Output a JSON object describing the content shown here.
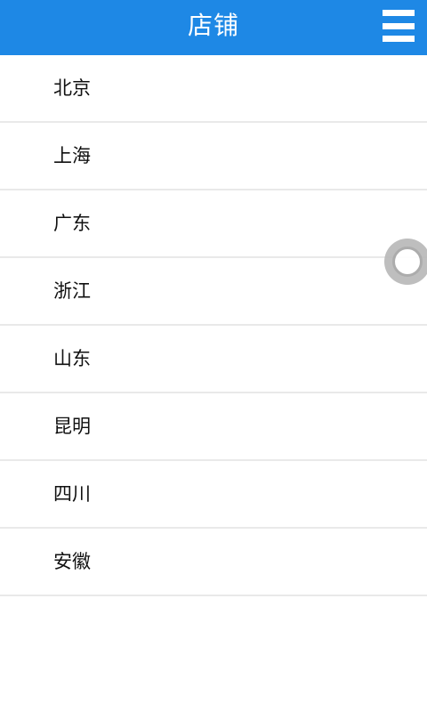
{
  "app_bar": {
    "title": "店铺",
    "menu_icon": "hamburger-menu-icon",
    "color": "#1e88e5"
  },
  "provinces": [
    {
      "label": "北京"
    },
    {
      "label": "上海"
    },
    {
      "label": "广东"
    },
    {
      "label": "浙江"
    },
    {
      "label": "山东"
    },
    {
      "label": "昆明"
    },
    {
      "label": "四川"
    },
    {
      "label": "安徽"
    }
  ],
  "floating_button": {
    "icon": "assistive-touch-icon"
  }
}
